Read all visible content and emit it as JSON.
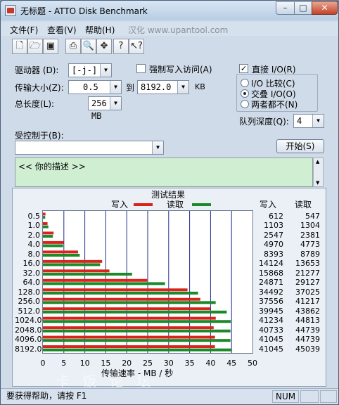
{
  "window": {
    "title": "无标题 - ATTO Disk Benchmark",
    "min_label": "–",
    "max_label": "□",
    "close_label": "✕"
  },
  "menu": [
    "文件(F)",
    "查看(V)",
    "帮助(H)",
    "汉化 www.upantool.com"
  ],
  "toolbar": [
    "new-icon",
    "open-icon",
    "save-icon",
    "print-icon",
    "print-preview-icon",
    "move-icon",
    "help-icon",
    "context-help-icon"
  ],
  "form": {
    "drive_label": "驱动器 (D):",
    "drive_value": "[-j-]",
    "force_write_label": "强制写入访问(A)",
    "direct_io_label": "直接 I/O(R)",
    "transfer_label": "传输大小(Z):",
    "transfer_from": "0.5",
    "to_label": "到",
    "transfer_to": "8192.0",
    "kb_label": "KB",
    "total_label": "总长度(L):",
    "total_value": "256 MB",
    "radio_options": [
      "I/O 比较(C)",
      "交叠 I/O(O)",
      "两者都不(N)"
    ],
    "queue_label": "队列深度(Q):",
    "queue_value": "4",
    "controlled_label": "受控制于(B):",
    "controlled_value": "",
    "start_label": "开始(S)",
    "description": "<<   你的描述   >>"
  },
  "results": {
    "title": "测试结果",
    "write_legend": "写入",
    "read_legend": "读取",
    "col_write": "写入",
    "col_read": "读取",
    "xlabel": "传输速率 - MB / 秒",
    "rows": [
      {
        "size": "0.5",
        "write": "612",
        "read": "547"
      },
      {
        "size": "1.0",
        "write": "1103",
        "read": "1304"
      },
      {
        "size": "2.0",
        "write": "2547",
        "read": "2381"
      },
      {
        "size": "4.0",
        "write": "4970",
        "read": "4773"
      },
      {
        "size": "8.0",
        "write": "8393",
        "read": "8789"
      },
      {
        "size": "16.0",
        "write": "14124",
        "read": "13653"
      },
      {
        "size": "32.0",
        "write": "15868",
        "read": "21277"
      },
      {
        "size": "64.0",
        "write": "24871",
        "read": "29127"
      },
      {
        "size": "128.0",
        "write": "34492",
        "read": "37025"
      },
      {
        "size": "256.0",
        "write": "37556",
        "read": "41217"
      },
      {
        "size": "512.0",
        "write": "39945",
        "read": "43862"
      },
      {
        "size": "1024.0",
        "write": "41234",
        "read": "44813"
      },
      {
        "size": "2048.0",
        "write": "40733",
        "read": "44739"
      },
      {
        "size": "4096.0",
        "write": "41045",
        "read": "44739"
      },
      {
        "size": "8192.0",
        "write": "41045",
        "read": "45039"
      }
    ]
  },
  "chart_data": {
    "type": "bar",
    "categories": [
      "0.5",
      "1.0",
      "2.0",
      "4.0",
      "8.0",
      "16.0",
      "32.0",
      "64.0",
      "128.0",
      "256.0",
      "512.0",
      "1024.0",
      "2048.0",
      "4096.0",
      "8192.0"
    ],
    "series": [
      {
        "name": "写入",
        "color": "#d9241b",
        "values": [
          0.612,
          1.103,
          2.547,
          4.97,
          8.393,
          14.124,
          15.868,
          24.871,
          34.492,
          37.556,
          39.945,
          41.234,
          40.733,
          41.045,
          41.045
        ]
      },
      {
        "name": "读取",
        "color": "#1d8a2a",
        "values": [
          0.547,
          1.304,
          2.381,
          4.773,
          8.789,
          13.653,
          21.277,
          29.127,
          37.025,
          41.217,
          43.862,
          44.813,
          44.739,
          44.739,
          45.039
        ]
      }
    ],
    "xlabel": "传输速率 - MB / 秒",
    "xlim": [
      0,
      50
    ],
    "xticks": [
      "0",
      "5",
      "10",
      "15",
      "20",
      "25",
      "30",
      "35",
      "40",
      "45",
      "50"
    ]
  },
  "watermark": "卡 饭 论 坛",
  "status": {
    "help_text": "要获得帮助，请按 F1",
    "num": "NUM"
  }
}
